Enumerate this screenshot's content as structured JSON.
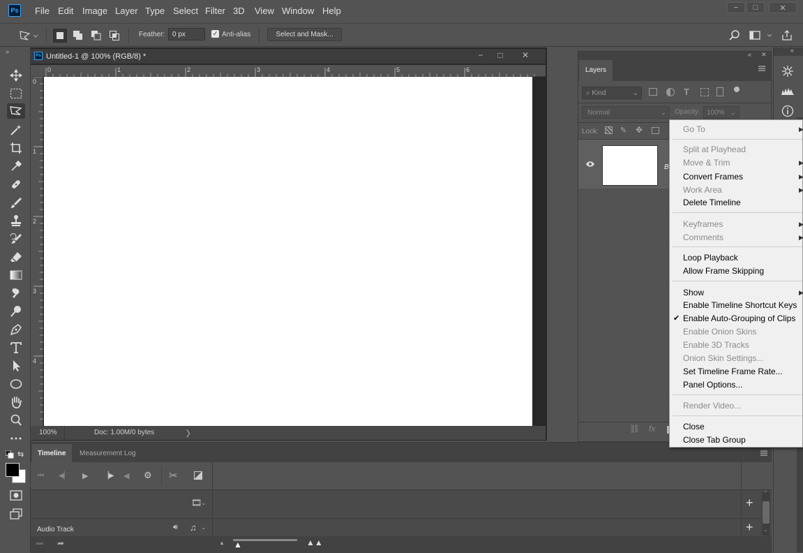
{
  "app": {
    "logo": "Ps",
    "name": "Photoshop"
  },
  "menu": [
    "File",
    "Edit",
    "Image",
    "Layer",
    "Type",
    "Select",
    "Filter",
    "3D",
    "View",
    "Window",
    "Help"
  ],
  "window_controls": {
    "minimize": "−",
    "maximize": "□",
    "close": "✕"
  },
  "options_bar": {
    "feather_label": "Feather:",
    "feather_value": "0 px",
    "antialias_label": "Anti-alias",
    "antialias_checked": true,
    "select_mask_label": "Select and Mask..."
  },
  "document": {
    "title": "Untitled-1 @ 100% (RGB/8) *",
    "icon": "Ps",
    "zoom": "100%",
    "doc_info": "Doc: 1.00M/0 bytes",
    "h_ruler": [
      "0",
      "1",
      "2",
      "3",
      "4",
      "5",
      "6"
    ],
    "v_ruler": [
      "0",
      "1",
      "2",
      "3",
      "4"
    ]
  },
  "layers_panel": {
    "tab": "Layers",
    "kind": "Kind",
    "blend_mode": "Normal",
    "opacity_label": "Opacity:",
    "opacity_value": "100%",
    "lock_label": "Lock:"
  },
  "timeline": {
    "tabs": [
      "Timeline",
      "Measurement Log"
    ],
    "audio_track": "Audio Track"
  },
  "context_menu": [
    {
      "label": "Go To",
      "disabled": true,
      "submenu": true
    },
    {
      "sep": true
    },
    {
      "label": "Split at Playhead",
      "disabled": true
    },
    {
      "label": "Move & Trim",
      "disabled": true,
      "submenu": true
    },
    {
      "label": "Convert Frames",
      "disabled": false,
      "submenu": true
    },
    {
      "label": "Work Area",
      "disabled": true,
      "submenu": true
    },
    {
      "label": "Delete Timeline",
      "disabled": false
    },
    {
      "sep": true
    },
    {
      "label": "Keyframes",
      "disabled": true,
      "submenu": true
    },
    {
      "label": "Comments",
      "disabled": true,
      "submenu": true
    },
    {
      "sep": true
    },
    {
      "label": "Loop Playback",
      "disabled": false
    },
    {
      "label": "Allow Frame Skipping",
      "disabled": false
    },
    {
      "sep": true
    },
    {
      "label": "Show",
      "disabled": false,
      "submenu": true
    },
    {
      "label": "Enable Timeline Shortcut Keys",
      "disabled": false
    },
    {
      "label": "Enable Auto-Grouping of Clips",
      "disabled": false,
      "checked": true
    },
    {
      "label": "Enable Onion Skins",
      "disabled": true
    },
    {
      "label": "Enable 3D Tracks",
      "disabled": true
    },
    {
      "label": "Onion Skin Settings...",
      "disabled": true
    },
    {
      "label": "Set Timeline Frame Rate...",
      "disabled": false
    },
    {
      "label": "Panel Options...",
      "disabled": false
    },
    {
      "sep": true
    },
    {
      "label": "Render Video...",
      "disabled": true
    },
    {
      "sep": true
    },
    {
      "label": "Close",
      "disabled": false
    },
    {
      "label": "Close Tab Group",
      "disabled": false
    }
  ],
  "colors": {
    "accent": "#31a8ff",
    "panel": "#535353",
    "dark": "#282828",
    "menu_bg": "#f0f0f0"
  }
}
